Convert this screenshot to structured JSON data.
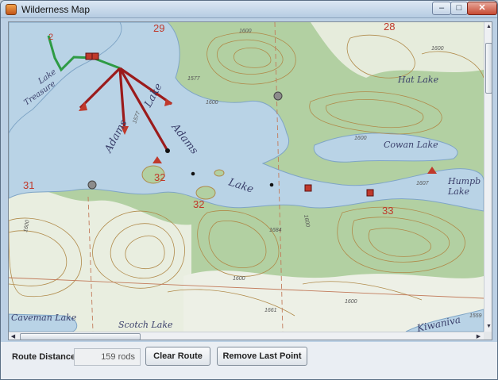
{
  "window": {
    "title": "Wilderness Map",
    "buttons": {
      "minimize": "–",
      "maximize": "□",
      "close": "✕"
    }
  },
  "map": {
    "lake_labels": {
      "treasure": "Treasure",
      "lake_left": "Lake",
      "adams_1": "Adams",
      "lake_top": "Lake",
      "adams_2": "Adams",
      "lake_mid": "Lake",
      "hat": "Hat Lake",
      "cowan": "Cowan Lake",
      "humpback_1": "Humpb",
      "humpback_2": "Lake",
      "caveman": "Caveman Lake",
      "scotch": "Scotch Lake",
      "kiwaniva": "Kiwaniva"
    },
    "section_numbers": {
      "s29": "29",
      "s28": "28",
      "s31": "31",
      "s32a": "32",
      "s32b": "32",
      "s33": "33",
      "s2": "2"
    },
    "elevations": {
      "e1600a": "1600",
      "e1577a": "1577",
      "e1600b": "1600",
      "e1600c": "1600",
      "e1577b": "1577",
      "e1600d": "1600",
      "e1600e": "1600",
      "e1607": "1607",
      "e1600f": "1600",
      "e1600g": "1600",
      "e1684": "1684",
      "e1600h": "1600",
      "e1661": "1661",
      "e1559": "1559"
    },
    "colors": {
      "water": "#b9d3e6",
      "forest": "#b2d0a2",
      "clearing": "#edf0e6",
      "contour": "#b08a4a",
      "route_red": "#9b1b1b",
      "route_green": "#2e9b44"
    }
  },
  "bottom_bar": {
    "route_distance_label": "Route Distance:",
    "route_distance_value": "159 rods",
    "clear_route_label": "Clear Route",
    "remove_last_point_label": "Remove Last Point"
  }
}
